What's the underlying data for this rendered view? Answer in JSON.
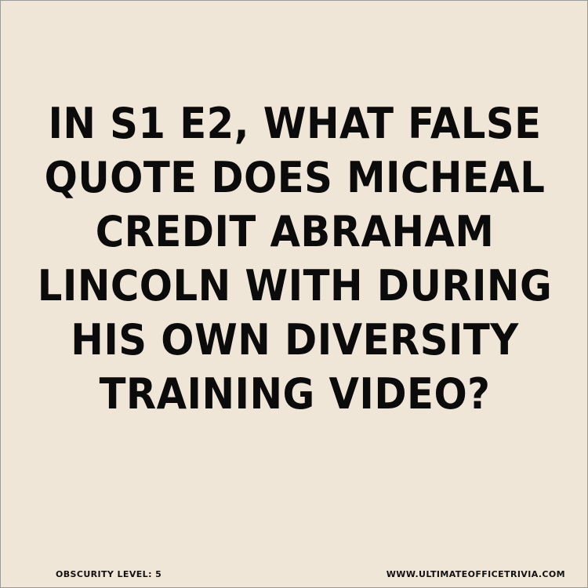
{
  "question": {
    "lines": [
      "IN S1 E2, WHAT FALSE",
      "QUOTE DOES MICHEAL",
      "CREDIT ABRAHAM",
      "LINCOLN WITH DURING",
      "HIS OWN DIVERSITY",
      "TRAINING VIDEO?"
    ]
  },
  "footer": {
    "obscurity": "OBSCURITY LEVEL: 5",
    "website": "WWW.ULTIMATEOFFICETRIVIA.COM"
  },
  "colors": {
    "background": "#efe6d7",
    "text": "#0b0b0b"
  }
}
